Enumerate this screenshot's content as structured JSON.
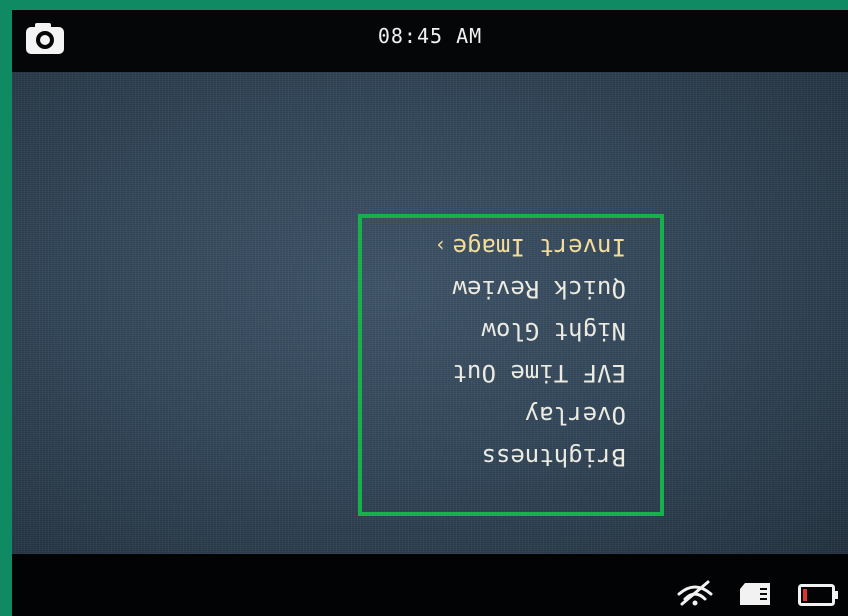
{
  "status_bar": {
    "time": "08:45 AM"
  },
  "menu": {
    "items": [
      {
        "label": "Brightness",
        "selected": false
      },
      {
        "label": "Overlay",
        "selected": false
      },
      {
        "label": "EVF Time Out",
        "selected": false
      },
      {
        "label": "Night Glow",
        "selected": false
      },
      {
        "label": "Quick Review",
        "selected": false
      },
      {
        "label": "Invert Image",
        "selected": true
      }
    ],
    "orientation": "upside-down",
    "border_color": "#18b04a",
    "selected_color": "#f4dc9a"
  },
  "indicators": {
    "wifi": "wifi-icon",
    "sd_card": "sd-card-icon",
    "battery": "battery-low-icon",
    "battery_level_fraction": 0.15,
    "battery_color": "#e0322e"
  },
  "icons": {
    "camera": "camera-icon"
  }
}
